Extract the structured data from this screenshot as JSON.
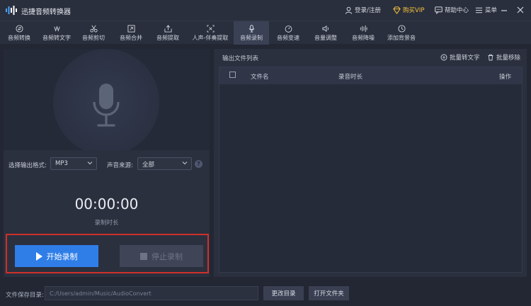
{
  "app": {
    "title": "迅捷音频转换器"
  },
  "header": {
    "login": "登录/注册",
    "vip": "购买VIP",
    "help": "帮助中心",
    "menu": "菜单"
  },
  "toolbar": {
    "items": [
      {
        "label": "音频转换",
        "icon": "convert-icon"
      },
      {
        "label": "音频转文字",
        "icon": "audio-to-text-icon"
      },
      {
        "label": "音频剪切",
        "icon": "scissors-icon"
      },
      {
        "label": "音频合并",
        "icon": "merge-icon"
      },
      {
        "label": "音频提取",
        "icon": "extract-icon"
      },
      {
        "label": "人声-伴奏提取",
        "icon": "vocal-separate-icon"
      },
      {
        "label": "音频录制",
        "icon": "microphone-icon"
      },
      {
        "label": "音频变速",
        "icon": "speed-icon"
      },
      {
        "label": "音量调整",
        "icon": "volume-icon"
      },
      {
        "label": "音频降噪",
        "icon": "noise-reduction-icon"
      },
      {
        "label": "添加背景音",
        "icon": "background-music-icon"
      }
    ],
    "active_index": 6
  },
  "recorder": {
    "format_label": "选择输出格式:",
    "format_value": "MP3",
    "source_label": "声音来源:",
    "source_value": "全部",
    "help_glyph": "?",
    "timer": "00:00:00",
    "timer_label": "录制时长",
    "start_label": "开始录制",
    "stop_label": "停止录制"
  },
  "output_list": {
    "title": "输出文件列表",
    "batch_convert": "批量转文字",
    "batch_remove": "批量移除",
    "columns": [
      "文件名",
      "录音时长",
      "操作"
    ]
  },
  "footer": {
    "path_label": "文件保存目录:",
    "path_value": "C:/Users/admin/Music/AudioConvert",
    "change_dir": "更改目录",
    "open_folder": "打开文件夹"
  },
  "colors": {
    "accent": "#2f7ee8",
    "highlight_border": "#d0302a",
    "vip": "#f3c23c",
    "background": "#232734"
  }
}
